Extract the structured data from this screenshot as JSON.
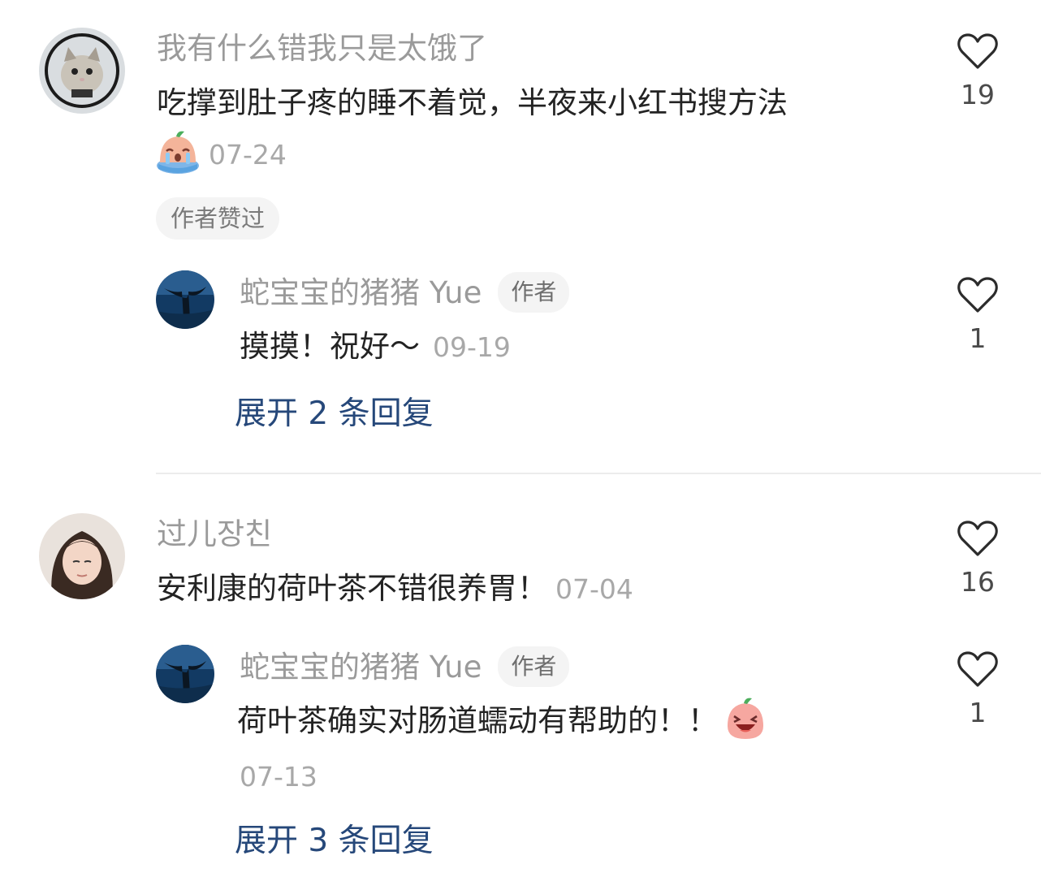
{
  "comments": [
    {
      "username": "我有什么错我只是太饿了",
      "text": "吃撑到肚子疼的睡不着觉，半夜来小红书搜方法",
      "date": "07-24",
      "liked_by_author_badge": "作者赞过",
      "likes": "19",
      "reply": {
        "username": "蛇宝宝的猪猪 Yue",
        "author_tag": "作者",
        "text": "摸摸！祝好～",
        "date": "09-19",
        "likes": "1"
      },
      "expand_label": "展开 2 条回复"
    },
    {
      "username": "过儿장친",
      "text": "安利康的荷叶茶不错很养胃！",
      "date": "07-04",
      "likes": "16",
      "reply": {
        "username": "蛇宝宝的猪猪 Yue",
        "author_tag": "作者",
        "text": "荷叶茶确实对肠道蠕动有帮助的！！",
        "date": "07-13",
        "likes": "1"
      },
      "expand_label": "展开 3 条回复"
    }
  ],
  "colors": {
    "expand_link": "#26487a",
    "username": "#9a9a9a",
    "date": "#a8a8a8"
  },
  "icons": {
    "like": "heart-outline-icon",
    "crying_sticker": "crying-peach-emoji",
    "laughing_sticker": "laughing-peach-emoji"
  }
}
